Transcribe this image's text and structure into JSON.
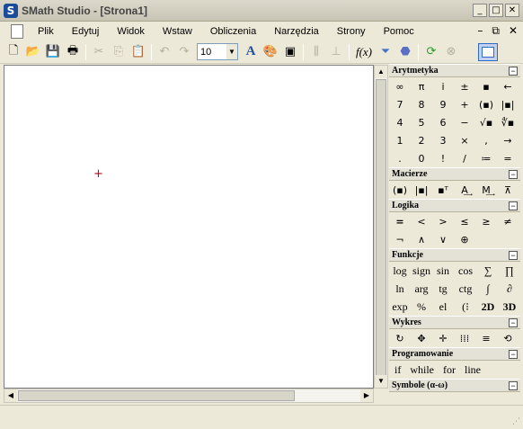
{
  "window": {
    "title": "SMath Studio - [Strona1]",
    "app_icon": "S"
  },
  "menu": {
    "items": [
      "Plik",
      "Edytuj",
      "Widok",
      "Wstaw",
      "Obliczenia",
      "Narzędzia",
      "Strony",
      "Pomoc"
    ]
  },
  "toolbar": {
    "font_size": "10",
    "fx_label": "f(x)"
  },
  "panel": {
    "sections": [
      {
        "title": "Arytmetyka",
        "rows": [
          [
            "∞",
            "π",
            "i",
            "±",
            "▪",
            "←"
          ],
          [
            "7",
            "8",
            "9",
            "+",
            "(▪)",
            "|▪|"
          ],
          [
            "4",
            "5",
            "6",
            "−",
            "√▪",
            "∜▪"
          ],
          [
            "1",
            "2",
            "3",
            "×",
            ",",
            "→"
          ],
          [
            ".",
            "0",
            "!",
            "/",
            "≔",
            "="
          ]
        ]
      },
      {
        "title": "Macierze",
        "rows": [
          [
            "(▪)",
            "|▪|",
            "▪ᵀ",
            "A͢",
            "M͢",
            "⊼"
          ]
        ]
      },
      {
        "title": "Logika",
        "rows": [
          [
            "=",
            "<",
            ">",
            "≤",
            "≥",
            "≠"
          ],
          [
            "¬",
            "∧",
            "∨",
            "⊕",
            "",
            ""
          ]
        ]
      },
      {
        "title": "Funkcje",
        "rows": [
          [
            "log",
            "sign",
            "sin",
            "cos",
            "∑",
            "∏"
          ],
          [
            "ln",
            "arg",
            "tg",
            "ctg",
            "∫",
            "∂"
          ],
          [
            "exp",
            "%",
            "el",
            "(⁝",
            "2D",
            "3D"
          ]
        ]
      },
      {
        "title": "Wykres",
        "rows": [
          [
            "↻",
            "✥",
            "✛",
            "⁞⁞⁞",
            "≡",
            "⟲"
          ]
        ]
      },
      {
        "title": "Programowanie",
        "items": [
          "if",
          "while",
          "for",
          "line"
        ]
      },
      {
        "title": "Symbole (α-ω)"
      }
    ]
  }
}
